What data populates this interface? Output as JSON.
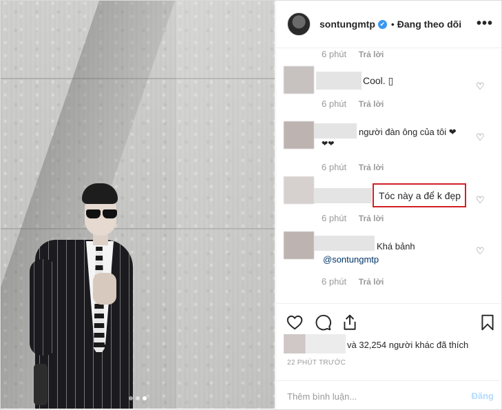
{
  "header": {
    "username": "sontungmtp",
    "verified_badge": "✔",
    "separator": "•",
    "follow_status": "Đang theo dõi",
    "more_glyph": "•••"
  },
  "comments": [
    {
      "time": "6 phút",
      "reply": "Trả lời"
    },
    {
      "text": "Cool. ▯",
      "time": "6 phút",
      "reply": "Trả lời"
    },
    {
      "text": "người đàn ông của tôi ❤",
      "text2": "❤❤",
      "time": "6 phút",
      "reply": "Trả lời"
    },
    {
      "text": "Tóc này a để k đẹp",
      "time": "6 phút",
      "reply": "Trả lời"
    },
    {
      "text": "Khá bảnh",
      "mention": "@sontungmtp",
      "time": "6 phút",
      "reply": "Trả lời"
    }
  ],
  "actions": {
    "likes_text": "và 32,254 người khác đã thích",
    "time_ago": "22 PHÚT TRƯỚC",
    "comment_placeholder": "Thêm bình luận...",
    "post_label": "Đăng"
  },
  "icons": {
    "heart": "heart-icon",
    "comment": "comment-icon",
    "share": "share-icon",
    "bookmark": "bookmark-icon"
  },
  "colors": {
    "verified_blue": "#3897f0",
    "highlight_red": "#d11f26",
    "post_disabled": "#b3dbff"
  },
  "carousel": {
    "count": 3,
    "active_index": 2
  }
}
